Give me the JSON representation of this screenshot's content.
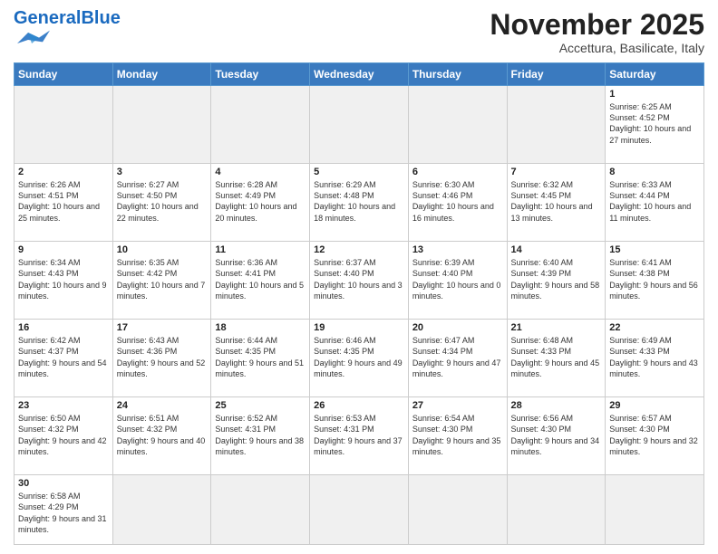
{
  "header": {
    "logo_general": "General",
    "logo_blue": "Blue",
    "month_title": "November 2025",
    "location": "Accettura, Basilicate, Italy"
  },
  "days_of_week": [
    "Sunday",
    "Monday",
    "Tuesday",
    "Wednesday",
    "Thursday",
    "Friday",
    "Saturday"
  ],
  "weeks": [
    [
      {
        "day": "",
        "empty": true
      },
      {
        "day": "",
        "empty": true
      },
      {
        "day": "",
        "empty": true
      },
      {
        "day": "",
        "empty": true
      },
      {
        "day": "",
        "empty": true
      },
      {
        "day": "",
        "empty": true
      },
      {
        "day": "1",
        "sunrise": "6:25 AM",
        "sunset": "4:52 PM",
        "daylight": "10 hours and 27 minutes."
      }
    ],
    [
      {
        "day": "2",
        "sunrise": "6:26 AM",
        "sunset": "4:51 PM",
        "daylight": "10 hours and 25 minutes."
      },
      {
        "day": "3",
        "sunrise": "6:27 AM",
        "sunset": "4:50 PM",
        "daylight": "10 hours and 22 minutes."
      },
      {
        "day": "4",
        "sunrise": "6:28 AM",
        "sunset": "4:49 PM",
        "daylight": "10 hours and 20 minutes."
      },
      {
        "day": "5",
        "sunrise": "6:29 AM",
        "sunset": "4:48 PM",
        "daylight": "10 hours and 18 minutes."
      },
      {
        "day": "6",
        "sunrise": "6:30 AM",
        "sunset": "4:46 PM",
        "daylight": "10 hours and 16 minutes."
      },
      {
        "day": "7",
        "sunrise": "6:32 AM",
        "sunset": "4:45 PM",
        "daylight": "10 hours and 13 minutes."
      },
      {
        "day": "8",
        "sunrise": "6:33 AM",
        "sunset": "4:44 PM",
        "daylight": "10 hours and 11 minutes."
      }
    ],
    [
      {
        "day": "9",
        "sunrise": "6:34 AM",
        "sunset": "4:43 PM",
        "daylight": "10 hours and 9 minutes."
      },
      {
        "day": "10",
        "sunrise": "6:35 AM",
        "sunset": "4:42 PM",
        "daylight": "10 hours and 7 minutes."
      },
      {
        "day": "11",
        "sunrise": "6:36 AM",
        "sunset": "4:41 PM",
        "daylight": "10 hours and 5 minutes."
      },
      {
        "day": "12",
        "sunrise": "6:37 AM",
        "sunset": "4:40 PM",
        "daylight": "10 hours and 3 minutes."
      },
      {
        "day": "13",
        "sunrise": "6:39 AM",
        "sunset": "4:40 PM",
        "daylight": "10 hours and 0 minutes."
      },
      {
        "day": "14",
        "sunrise": "6:40 AM",
        "sunset": "4:39 PM",
        "daylight": "9 hours and 58 minutes."
      },
      {
        "day": "15",
        "sunrise": "6:41 AM",
        "sunset": "4:38 PM",
        "daylight": "9 hours and 56 minutes."
      }
    ],
    [
      {
        "day": "16",
        "sunrise": "6:42 AM",
        "sunset": "4:37 PM",
        "daylight": "9 hours and 54 minutes."
      },
      {
        "day": "17",
        "sunrise": "6:43 AM",
        "sunset": "4:36 PM",
        "daylight": "9 hours and 52 minutes."
      },
      {
        "day": "18",
        "sunrise": "6:44 AM",
        "sunset": "4:35 PM",
        "daylight": "9 hours and 51 minutes."
      },
      {
        "day": "19",
        "sunrise": "6:46 AM",
        "sunset": "4:35 PM",
        "daylight": "9 hours and 49 minutes."
      },
      {
        "day": "20",
        "sunrise": "6:47 AM",
        "sunset": "4:34 PM",
        "daylight": "9 hours and 47 minutes."
      },
      {
        "day": "21",
        "sunrise": "6:48 AM",
        "sunset": "4:33 PM",
        "daylight": "9 hours and 45 minutes."
      },
      {
        "day": "22",
        "sunrise": "6:49 AM",
        "sunset": "4:33 PM",
        "daylight": "9 hours and 43 minutes."
      }
    ],
    [
      {
        "day": "23",
        "sunrise": "6:50 AM",
        "sunset": "4:32 PM",
        "daylight": "9 hours and 42 minutes."
      },
      {
        "day": "24",
        "sunrise": "6:51 AM",
        "sunset": "4:32 PM",
        "daylight": "9 hours and 40 minutes."
      },
      {
        "day": "25",
        "sunrise": "6:52 AM",
        "sunset": "4:31 PM",
        "daylight": "9 hours and 38 minutes."
      },
      {
        "day": "26",
        "sunrise": "6:53 AM",
        "sunset": "4:31 PM",
        "daylight": "9 hours and 37 minutes."
      },
      {
        "day": "27",
        "sunrise": "6:54 AM",
        "sunset": "4:30 PM",
        "daylight": "9 hours and 35 minutes."
      },
      {
        "day": "28",
        "sunrise": "6:56 AM",
        "sunset": "4:30 PM",
        "daylight": "9 hours and 34 minutes."
      },
      {
        "day": "29",
        "sunrise": "6:57 AM",
        "sunset": "4:30 PM",
        "daylight": "9 hours and 32 minutes."
      }
    ],
    [
      {
        "day": "30",
        "sunrise": "6:58 AM",
        "sunset": "4:29 PM",
        "daylight": "9 hours and 31 minutes.",
        "last": true
      },
      {
        "day": "",
        "empty": true,
        "last": true
      },
      {
        "day": "",
        "empty": true,
        "last": true
      },
      {
        "day": "",
        "empty": true,
        "last": true
      },
      {
        "day": "",
        "empty": true,
        "last": true
      },
      {
        "day": "",
        "empty": true,
        "last": true
      },
      {
        "day": "",
        "empty": true,
        "last": true
      }
    ]
  ]
}
